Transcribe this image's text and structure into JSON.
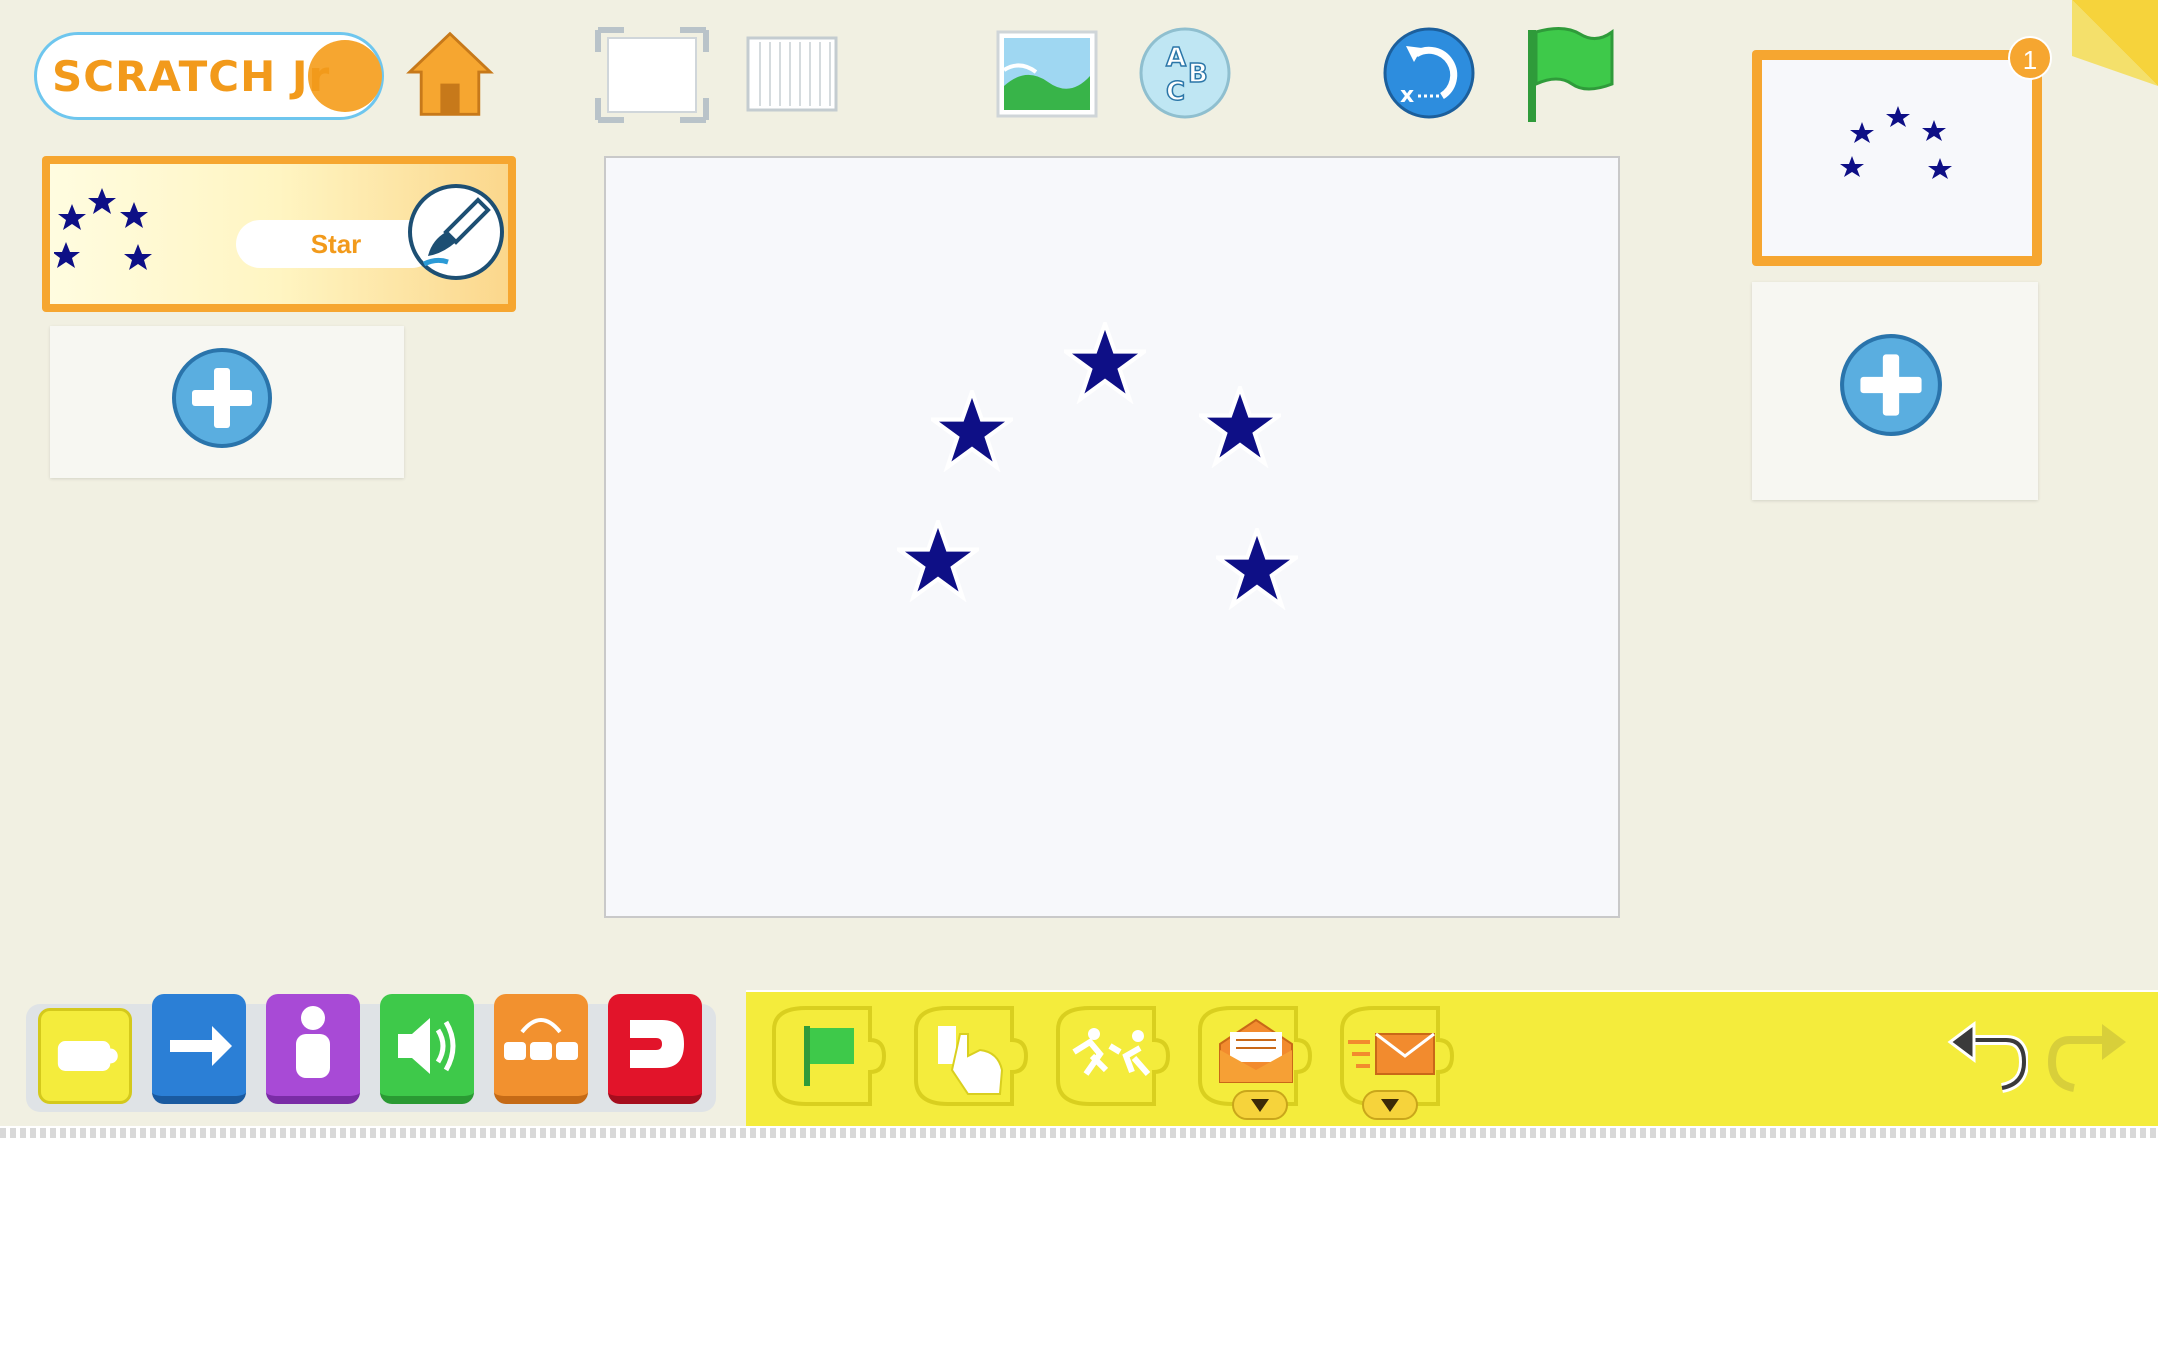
{
  "app": {
    "logo_text": "SCRATCH Jr"
  },
  "toolbar": {
    "home_icon": "home-icon",
    "fullscreen_icon": "fullscreen-icon",
    "grid_icon": "grid-icon",
    "background_icon": "background-icon",
    "text_icon": "text-abc-icon",
    "reset_icon": "reset-icon",
    "green_flag_icon": "green-flag-icon"
  },
  "sprites": [
    {
      "name": "Star",
      "icon": "stars-thumbnail",
      "edit_icon": "paintbrush-icon"
    }
  ],
  "add_sprite_icon": "plus-icon",
  "pages": [
    {
      "number": "1",
      "thumbnail": "stars-thumbnail"
    }
  ],
  "add_page_icon": "plus-icon",
  "categories": [
    {
      "id": "triggering",
      "color": "#f4ec3c"
    },
    {
      "id": "motion",
      "color": "#2b7fd6"
    },
    {
      "id": "looks",
      "color": "#a84ad6"
    },
    {
      "id": "sound",
      "color": "#3ec94a"
    },
    {
      "id": "control",
      "color": "#f2912f"
    },
    {
      "id": "end",
      "color": "#e2142a"
    }
  ],
  "blocks": [
    {
      "id": "start-on-green-flag",
      "icon": "green-flag-icon"
    },
    {
      "id": "start-on-tap",
      "icon": "tap-icon"
    },
    {
      "id": "start-on-bump",
      "icon": "bump-icon"
    },
    {
      "id": "start-on-message",
      "icon": "open-envelope-icon",
      "dropdown": true
    },
    {
      "id": "send-message",
      "icon": "send-envelope-icon",
      "dropdown": true
    }
  ],
  "colors": {
    "star": "#0e0f86",
    "accent_orange": "#f6a630",
    "palette_yellow": "#f4ec3c"
  }
}
